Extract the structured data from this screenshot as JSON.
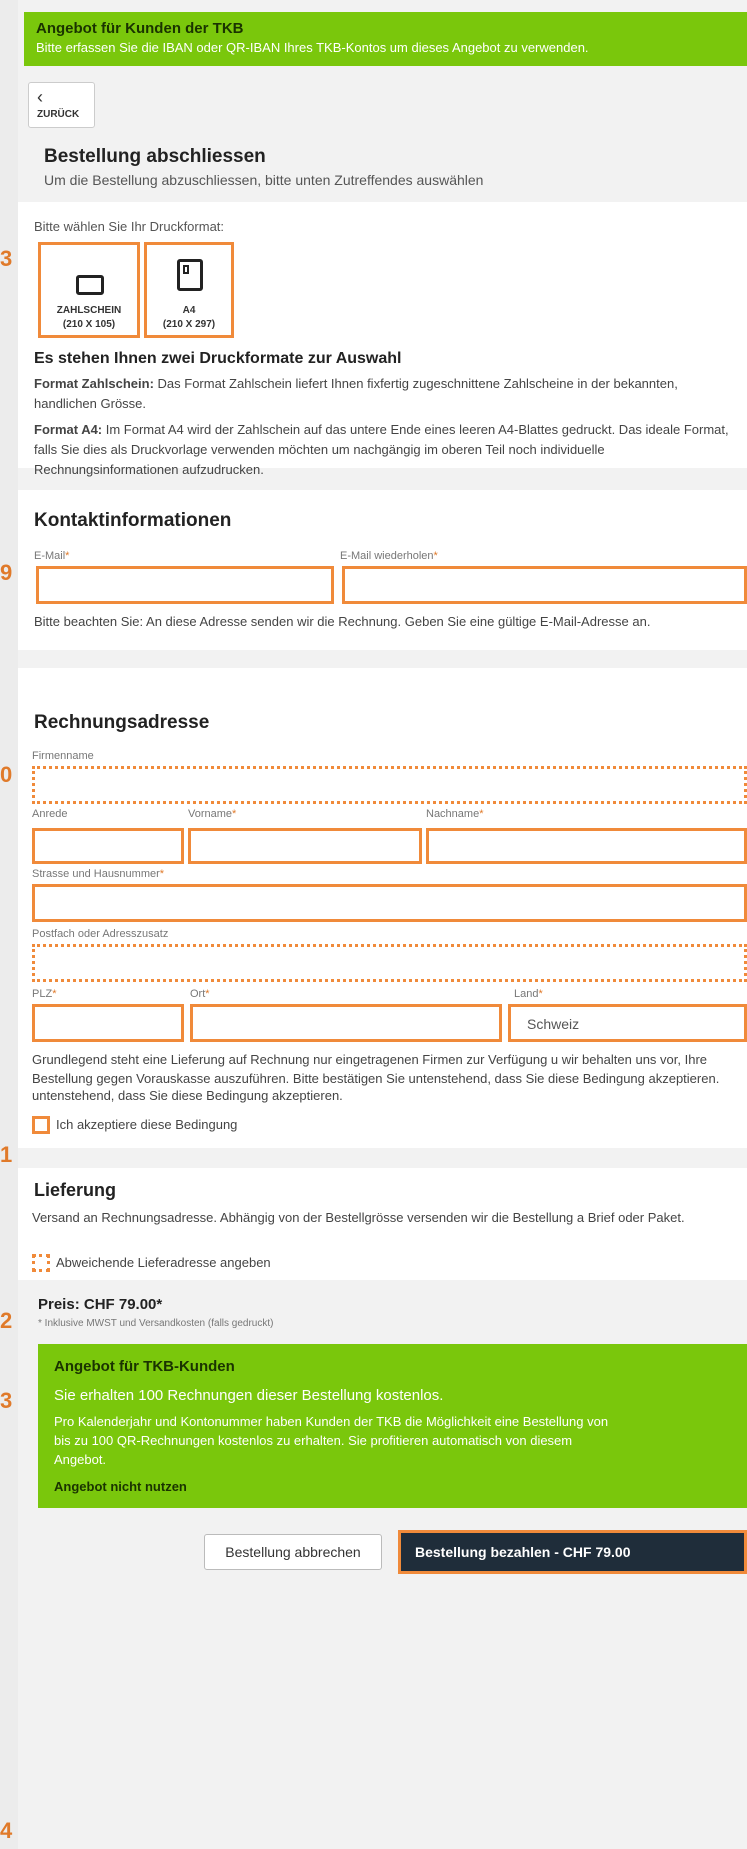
{
  "top_banner": {
    "title": "Angebot für Kunden der TKB",
    "text": "Bitte erfassen Sie die IBAN oder QR-IBAN Ihres TKB-Kontos um dieses Angebot zu verwenden."
  },
  "back": {
    "icon": "chevron-left-icon",
    "label": "ZURÜCK"
  },
  "order": {
    "title": "Bestellung abschliessen",
    "subtitle": "Um die Bestellung abzuschliessen, bitte unten Zutreffendes auswählen"
  },
  "format": {
    "prompt": "Bitte wählen Sie Ihr Druckformat:",
    "options": [
      {
        "line1": "ZAHLSCHEIN",
        "line2": "(210 X 105)"
      },
      {
        "line1": "A4",
        "line2": "(210 X 297)"
      }
    ],
    "heading": "Es stehen Ihnen zwei Druckformate zur Auswahl",
    "p1_bold": "Format Zahlschein:",
    "p1_text": " Das Format Zahlschein liefert Ihnen fixfertig zugeschnittene Zahlscheine in der bekannten, handlichen Grösse.",
    "p2_bold": "Format A4:",
    "p2_text": " Im Format A4 wird der Zahlschein auf das untere Ende eines leeren A4-Blattes gedruckt. Das ideale Format, falls Sie dies als Druckvorlage verwenden möchten um nachgängig im oberen Teil noch individuelle Rechnungsinformationen aufzudrucken."
  },
  "contact": {
    "title": "Kontaktinformationen",
    "email_label": "E-Mail",
    "email_repeat_label": "E-Mail wiederholen",
    "required_mark": "*",
    "note": "Bitte beachten Sie: An diese Adresse senden wir die Rechnung. Geben Sie eine gültige E-Mail-Adresse an."
  },
  "billing": {
    "title": "Rechnungsadresse",
    "company_label": "Firmenname",
    "salutation_label": "Anrede",
    "firstname_label": "Vorname",
    "lastname_label": "Nachname",
    "street_label": "Strasse und Hausnummer",
    "pobox_label": "Postfach oder Adresszusatz",
    "zip_label": "PLZ",
    "city_label": "Ort",
    "country_label": "Land",
    "country_value": "Schweiz",
    "terms_text": "Grundlegend steht eine Lieferung auf Rechnung nur eingetragenen Firmen zur Verfügung u wir behalten uns vor, Ihre Bestellung gegen Vorauskasse auszuführen. Bitte bestätigen Sie untenstehend, dass Sie diese Bedingung akzeptieren.",
    "accept_label": "Ich akzeptiere diese Bedingung"
  },
  "delivery": {
    "title": "Lieferung",
    "text": "Versand an Rechnungsadresse. Abhängig von der Bestellgrösse versenden wir die Bestellung a Brief oder Paket.",
    "alt_address_label": "Abweichende Lieferadresse angeben"
  },
  "price": {
    "title": "Preis: CHF 79.00*",
    "note": "* Inklusive MWST und Versandkosten (falls gedruckt)"
  },
  "offer": {
    "title": "Angebot für TKB-Kunden",
    "headline": "Sie erhalten 100 Rechnungen dieser Bestellung kostenlos.",
    "text": "Pro Kalenderjahr und Kontonummer haben Kunden der TKB die Möglichkeit eine Bestellung von bis zu 100 QR-Rechnungen kostenlos zu erhalten. Sie profitieren automatisch von diesem Angebot.",
    "decline_link": "Angebot nicht nutzen"
  },
  "actions": {
    "cancel_label": "Bestellung abbrechen",
    "pay_label": "Bestellung bezahlen - CHF 79.00"
  },
  "markers": [
    "3",
    "9",
    "0",
    "1",
    "2",
    "3",
    "4"
  ],
  "colors": {
    "accent_green": "#7ac70c",
    "highlight_orange": "#f08a3a",
    "pay_button": "#1f2d3a"
  }
}
